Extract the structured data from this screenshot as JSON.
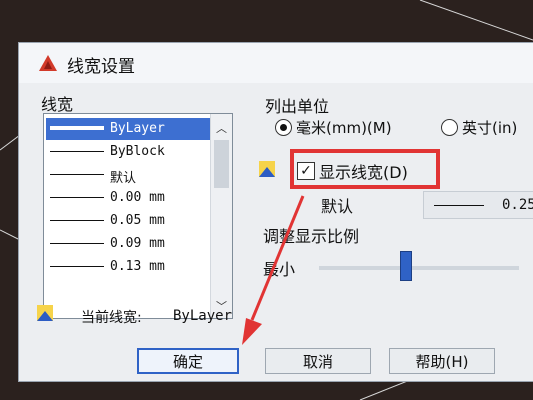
{
  "dialog": {
    "title": "线宽设置",
    "lineweights_label": "线宽",
    "lineweights": [
      {
        "label": "ByLayer",
        "thickness": 4,
        "selected": true
      },
      {
        "label": "ByBlock",
        "thickness": 1,
        "selected": false
      },
      {
        "label": "默认",
        "thickness": 1,
        "selected": false
      },
      {
        "label": "0.00 mm",
        "thickness": 1,
        "selected": false
      },
      {
        "label": "0.05 mm",
        "thickness": 1,
        "selected": false
      },
      {
        "label": "0.09 mm",
        "thickness": 1,
        "selected": false
      },
      {
        "label": "0.13 mm",
        "thickness": 1,
        "selected": false
      }
    ],
    "units_label": "列出单位",
    "unit_mm": "毫米(mm)(M)",
    "unit_in": "英寸(in)",
    "display_lineweight": "显示线宽(D)",
    "display_checked": true,
    "default_label": "默认",
    "default_value": "0.25",
    "adjust_scale_label": "调整显示比例",
    "scale_min": "最小",
    "current_label": "当前线宽:",
    "current_value": "ByLayer",
    "ok": "确定",
    "cancel": "取消",
    "help": "帮助(H)"
  },
  "colors": {
    "accent": "#2f62c6",
    "selection": "#3d6fd1",
    "highlight": "#e13434",
    "background": "#2b211e"
  },
  "slider_level": 0.42
}
